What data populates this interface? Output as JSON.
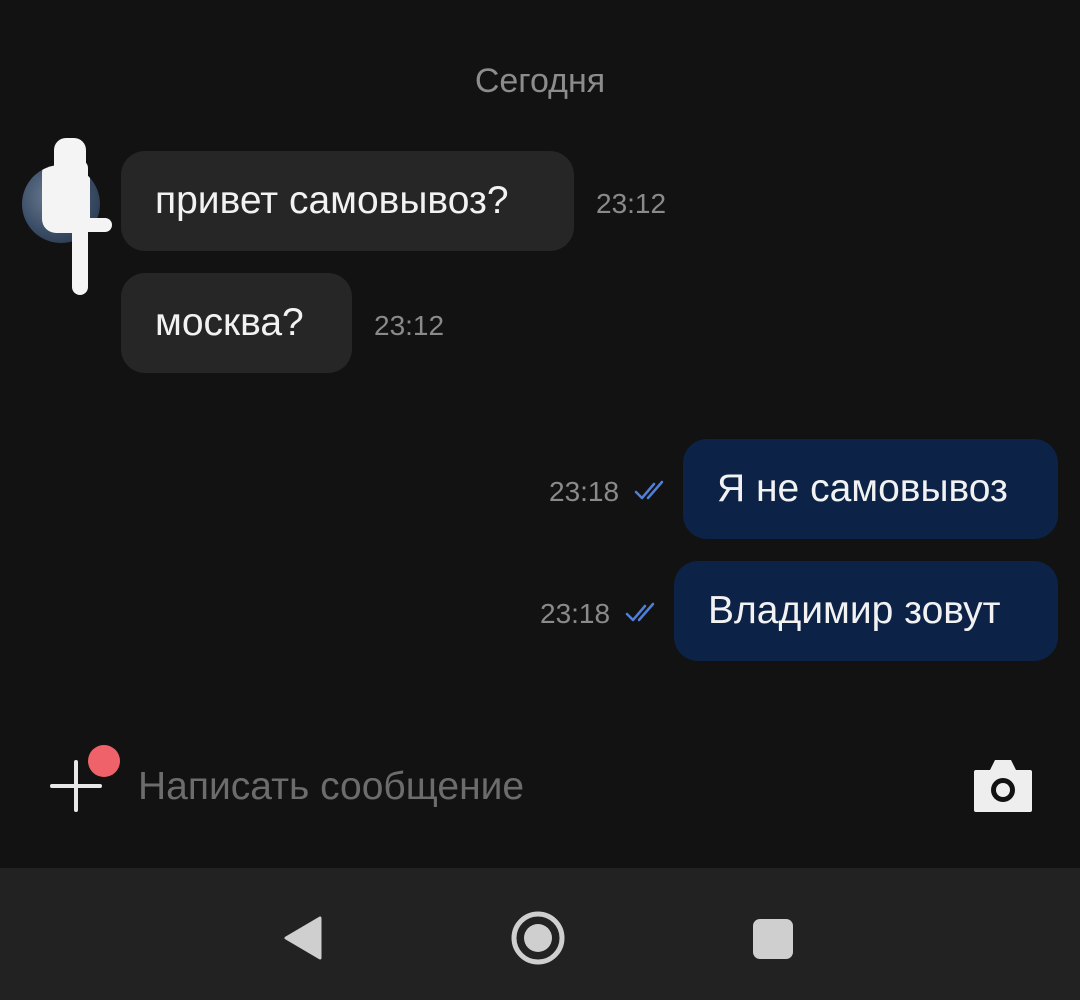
{
  "chat": {
    "date_separator": "Сегодня",
    "messages": [
      {
        "direction": "incoming",
        "text": "привет самовывоз?",
        "time": "23:12"
      },
      {
        "direction": "incoming",
        "text": "москва?",
        "time": "23:12"
      },
      {
        "direction": "outgoing",
        "text": "Я не самовывоз",
        "time": "23:18",
        "status": "read"
      },
      {
        "direction": "outgoing",
        "text": "Владимир зовут",
        "time": "23:18",
        "status": "read"
      }
    ]
  },
  "composer": {
    "placeholder": "Написать сообщение",
    "value": "",
    "attach_icon": "plus-icon",
    "attach_badge_color": "#f0626a",
    "camera_icon": "camera-icon"
  },
  "navigation_bar": {
    "back_icon": "back-triangle-icon",
    "home_icon": "home-circle-icon",
    "recents_icon": "recents-square-icon"
  },
  "colors": {
    "background": "#121212",
    "incoming_bubble": "#262626",
    "outgoing_bubble": "#0c2347",
    "read_ticks": "#4f7fd6"
  }
}
